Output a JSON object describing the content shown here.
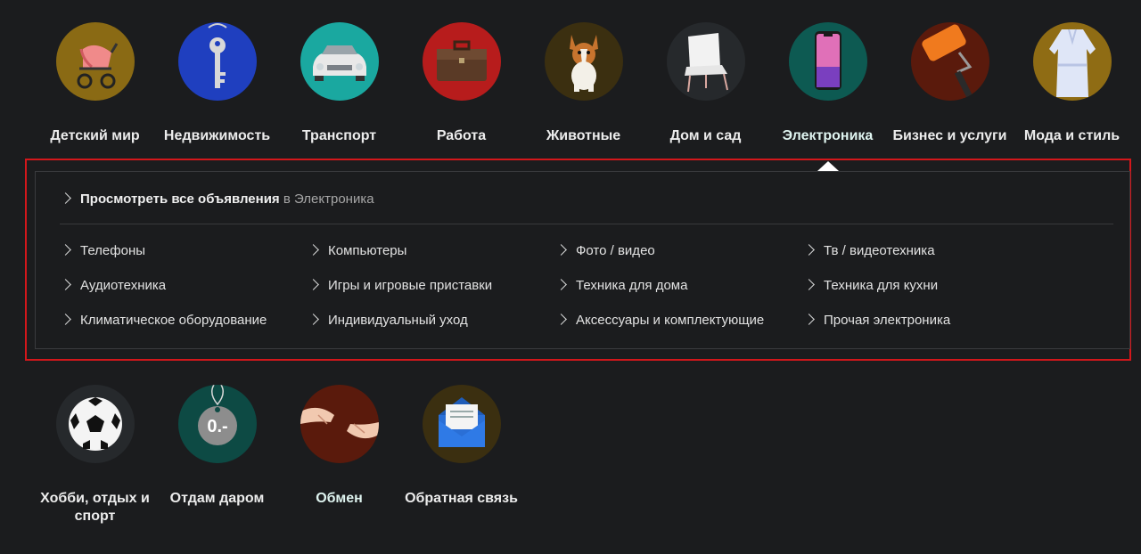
{
  "categories_row1": [
    {
      "label": "Детский мир",
      "icon": "stroller-icon",
      "bg": "#8a6a14"
    },
    {
      "label": "Недвижимость",
      "icon": "key-icon",
      "bg": "#1f3fbf"
    },
    {
      "label": "Транспорт",
      "icon": "car-icon",
      "bg": "#1aa8a0"
    },
    {
      "label": "Работа",
      "icon": "briefcase-icon",
      "bg": "#b71c1c"
    },
    {
      "label": "Животные",
      "icon": "dog-icon",
      "bg": "#3b2f10"
    },
    {
      "label": "Дом и сад",
      "icon": "chair-icon",
      "bg": "#26292c"
    },
    {
      "label": "Электроника",
      "icon": "phone-icon",
      "bg": "#0d5a52"
    },
    {
      "label": "Бизнес и услуги",
      "icon": "paint-roller-icon",
      "bg": "#5a1a0c"
    },
    {
      "label": "Мода и стиль",
      "icon": "robe-icon",
      "bg": "#8f6c14"
    }
  ],
  "categories_row2": [
    {
      "label": "Хобби, отдых и спорт",
      "icon": "soccer-ball-icon",
      "bg": "#26292c"
    },
    {
      "label": "Отдам даром",
      "icon": "price-tag-icon",
      "bg": "#0d4a44",
      "tag_text": "0.-"
    },
    {
      "label": "Обмен",
      "icon": "handshake-icon",
      "bg": "#5a1a0c"
    },
    {
      "label": "Обратная связь",
      "icon": "envelope-icon",
      "bg": "#3b2f10"
    }
  ],
  "active_category": "Электроника",
  "panel": {
    "view_all_bold": "Просмотреть все объявления",
    "view_all_in": "в Электроника",
    "subcategories": [
      [
        "Телефоны",
        "Компьютеры",
        "Фото / видео",
        "Тв / видеотехника"
      ],
      [
        "Аудиотехника",
        "Игры и игровые приставки",
        "Техника для дома",
        "Техника для кухни"
      ],
      [
        "Климатическое оборудование",
        "Индивидуальный уход",
        "Аксессуары и комплектующие",
        "Прочая электроника"
      ]
    ]
  },
  "colors": {
    "background": "#1b1c1e",
    "highlight_border": "#d3171b",
    "panel_border": "#3a3b3e"
  }
}
